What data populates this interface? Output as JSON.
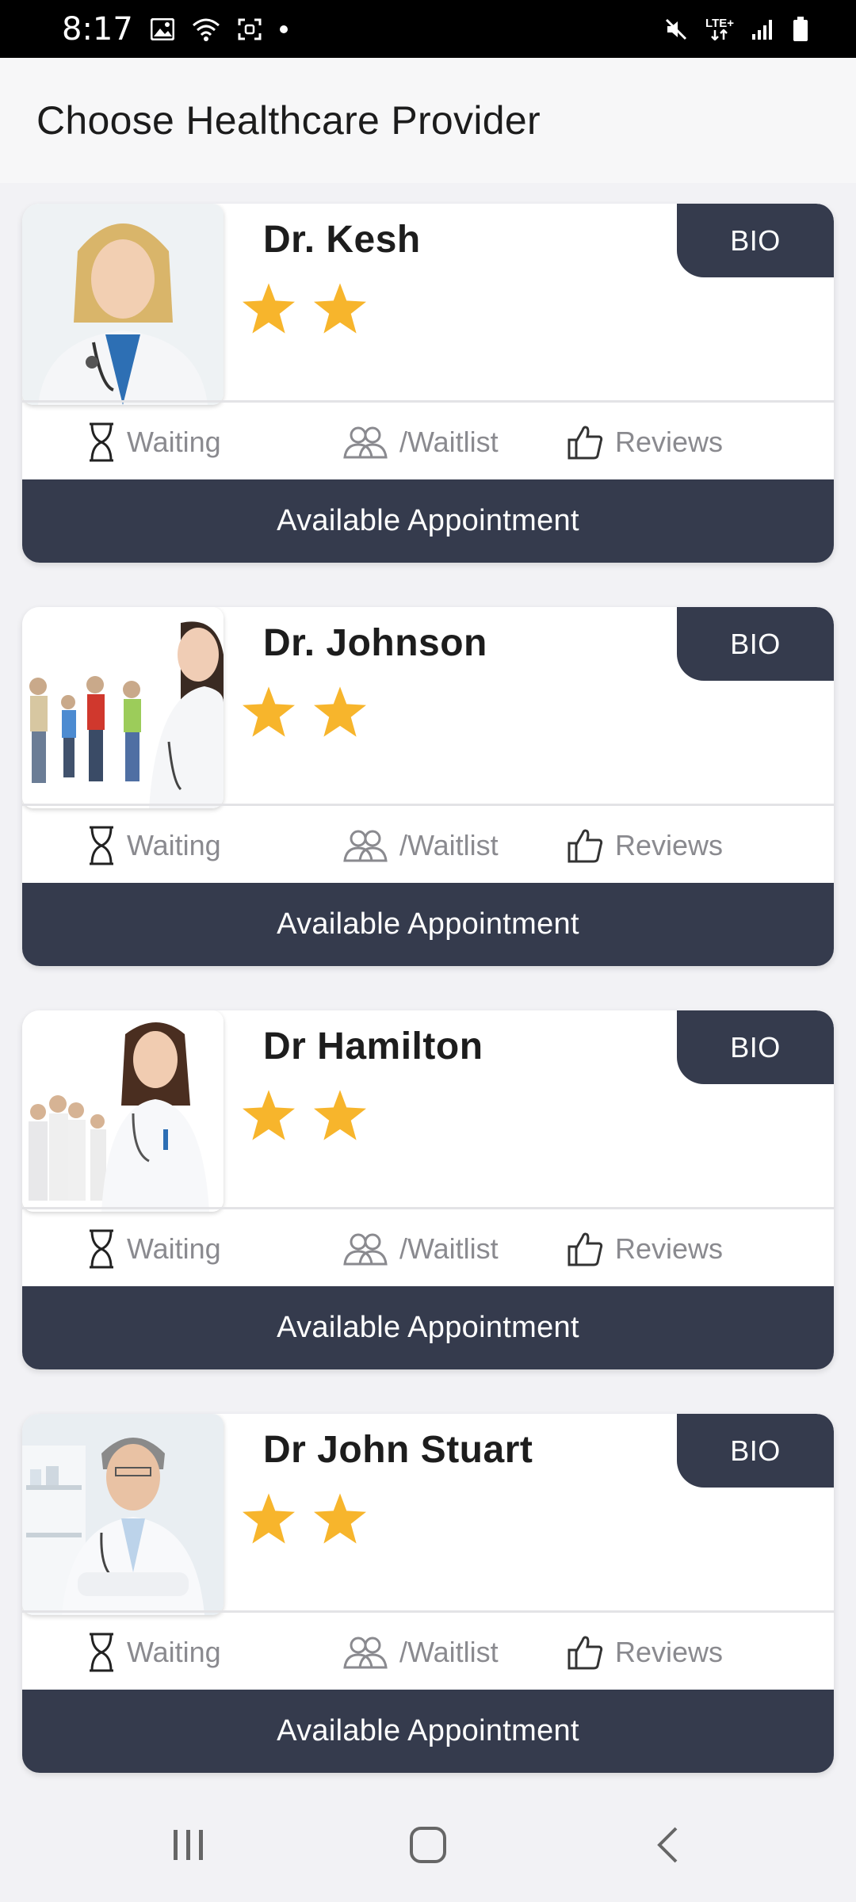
{
  "status_bar": {
    "time": "8:17",
    "network": "LTE+"
  },
  "header": {
    "title": "Choose Healthcare Provider"
  },
  "colors": {
    "button_dark": "#353b4d",
    "star": "#f7b52c",
    "stat_text": "#8a8a8f"
  },
  "providers": [
    {
      "name": "Dr. Kesh",
      "bio_label": "BIO",
      "rating_stars": 2,
      "waiting_label": "Waiting",
      "waitlist_label": "/Waitlist",
      "reviews_label": "Reviews",
      "appointment_label": "Available Appointment"
    },
    {
      "name": "Dr. Johnson",
      "bio_label": "BIO",
      "rating_stars": 2,
      "waiting_label": "Waiting",
      "waitlist_label": "/Waitlist",
      "reviews_label": "Reviews",
      "appointment_label": "Available Appointment"
    },
    {
      "name": "Dr Hamilton",
      "bio_label": "BIO",
      "rating_stars": 2,
      "waiting_label": "Waiting",
      "waitlist_label": "/Waitlist",
      "reviews_label": "Reviews",
      "appointment_label": "Available Appointment"
    },
    {
      "name": "Dr John Stuart",
      "bio_label": "BIO",
      "rating_stars": 2,
      "waiting_label": "Waiting",
      "waitlist_label": "/Waitlist",
      "reviews_label": "Reviews",
      "appointment_label": "Available Appointment"
    }
  ],
  "icons": {
    "waiting": "hourglass-icon",
    "waitlist": "people-icon",
    "reviews": "thumbs-up-icon",
    "nav_recent": "recent-apps-icon",
    "nav_home": "home-icon",
    "nav_back": "back-icon"
  }
}
